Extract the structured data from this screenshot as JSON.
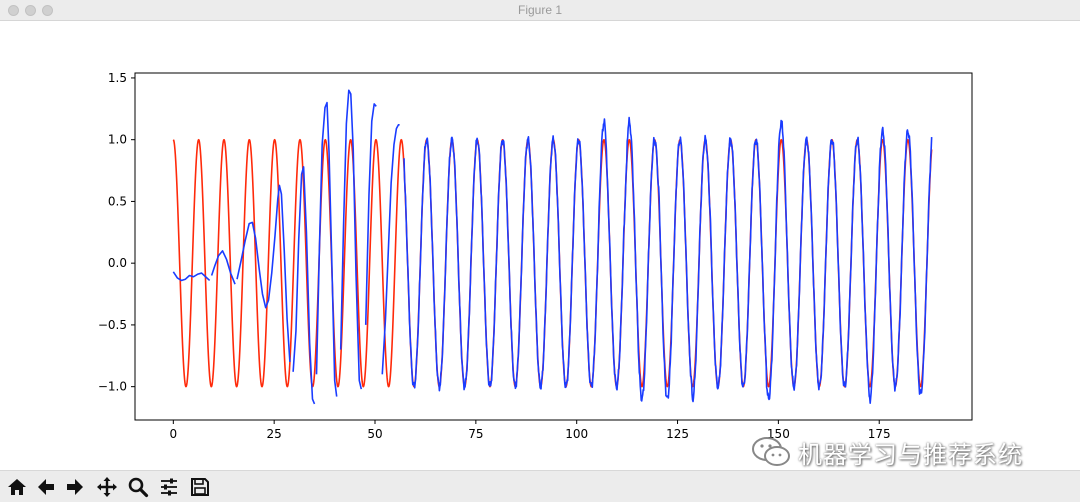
{
  "window": {
    "title": "Figure 1"
  },
  "toolbar": {
    "buttons": [
      {
        "name": "home-button",
        "icon": "home-icon"
      },
      {
        "name": "back-button",
        "icon": "arrow-left-icon"
      },
      {
        "name": "forward-button",
        "icon": "arrow-right-icon"
      },
      {
        "name": "pan-button",
        "icon": "move-icon"
      },
      {
        "name": "zoom-button",
        "icon": "magnifier-icon"
      },
      {
        "name": "configure-subplots-button",
        "icon": "sliders-icon"
      },
      {
        "name": "save-button",
        "icon": "floppy-disk-icon"
      }
    ]
  },
  "watermark": {
    "text": "机器学习与推荐系统",
    "icon": "wechat-icon"
  },
  "chart_data": {
    "type": "line",
    "title": "",
    "xlabel": "",
    "ylabel": "",
    "xlim": [
      -9.5,
      198
    ],
    "ylim": [
      -1.27,
      1.54
    ],
    "xticks": [
      0,
      25,
      50,
      75,
      100,
      125,
      150,
      175
    ],
    "yticks": [
      -1.0,
      -0.5,
      0.0,
      0.5,
      1.0,
      1.5
    ],
    "ytick_labels": [
      "−1.0",
      "−0.5",
      "0.0",
      "0.5",
      "1.0",
      "1.5"
    ],
    "grid": false,
    "series": [
      {
        "color": "#ff2a0a",
        "function": "cos",
        "period": 6.28,
        "amplitude": 1.0,
        "x_range": [
          0,
          188
        ]
      },
      {
        "color": "#1a3cff",
        "segments": [
          [
            [
              0,
              -0.07
            ],
            [
              1,
              -0.12
            ],
            [
              2,
              -0.14
            ],
            [
              3,
              -0.13
            ],
            [
              4,
              -0.1
            ],
            [
              5,
              -0.11
            ],
            [
              6,
              -0.09
            ],
            [
              7,
              -0.08
            ],
            [
              8,
              -0.11
            ],
            [
              9,
              -0.14
            ]
          ],
          [
            [
              9.5,
              -0.1
            ],
            [
              10.3,
              -0.02
            ],
            [
              11.2,
              0.06
            ],
            [
              12.2,
              0.1
            ],
            [
              13.2,
              0.03
            ],
            [
              14.2,
              -0.08
            ],
            [
              15.3,
              -0.17
            ]
          ],
          [
            [
              15.8,
              -0.13
            ],
            [
              16.8,
              0.02
            ],
            [
              17.8,
              0.18
            ],
            [
              18.8,
              0.32
            ],
            [
              19.6,
              0.33
            ],
            [
              20.4,
              0.2
            ],
            [
              21.3,
              -0.05
            ],
            [
              22.1,
              -0.25
            ],
            [
              22.9,
              -0.36
            ],
            [
              23.6,
              -0.3
            ],
            [
              24.4,
              -0.08
            ],
            [
              25.2,
              0.22
            ],
            [
              25.9,
              0.52
            ],
            [
              26.3,
              0.63
            ],
            [
              26.8,
              0.56
            ],
            [
              27.5,
              0.1
            ],
            [
              28.2,
              -0.45
            ],
            [
              28.9,
              -0.8
            ]
          ],
          [
            [
              29.7,
              -0.88
            ],
            [
              30.4,
              -0.55
            ],
            [
              31.1,
              0.2
            ],
            [
              31.8,
              0.72
            ],
            [
              32.3,
              0.78
            ],
            [
              33.0,
              0.25
            ],
            [
              33.8,
              -0.65
            ],
            [
              34.5,
              -1.1
            ],
            [
              35.0,
              -1.14
            ]
          ],
          [
            [
              35.5,
              -0.9
            ],
            [
              36.2,
              0.1
            ],
            [
              36.9,
              0.96
            ],
            [
              37.6,
              1.26
            ],
            [
              38.1,
              1.3
            ],
            [
              38.6,
              0.9
            ],
            [
              39.3,
              0.0
            ],
            [
              40.0,
              -0.95
            ],
            [
              40.5,
              -1.08
            ]
          ],
          [
            [
              41.5,
              -0.7
            ],
            [
              42.2,
              0.3
            ],
            [
              42.9,
              1.13
            ],
            [
              43.5,
              1.4
            ],
            [
              44.0,
              1.37
            ],
            [
              44.6,
              0.92
            ],
            [
              45.3,
              -0.1
            ],
            [
              46.1,
              -0.95
            ],
            [
              46.6,
              -1.02
            ]
          ],
          [
            [
              47.7,
              -0.5
            ],
            [
              48.5,
              0.55
            ],
            [
              49.2,
              1.15
            ],
            [
              49.8,
              1.29
            ],
            [
              50.3,
              1.27
            ]
          ],
          [
            [
              51.8,
              -0.9
            ],
            [
              52.6,
              -0.45
            ],
            [
              53.3,
              0.1
            ],
            [
              54.0,
              0.65
            ],
            [
              54.7,
              0.96
            ],
            [
              55.3,
              1.09
            ],
            [
              55.8,
              1.12
            ],
            [
              56.1,
              1.12
            ]
          ]
        ],
        "sine_tail": {
          "x_range": [
            57.2,
            188
          ],
          "period": 6.28,
          "phase_ref_x": 62.8,
          "amplitude": 1.0
        }
      }
    ]
  }
}
